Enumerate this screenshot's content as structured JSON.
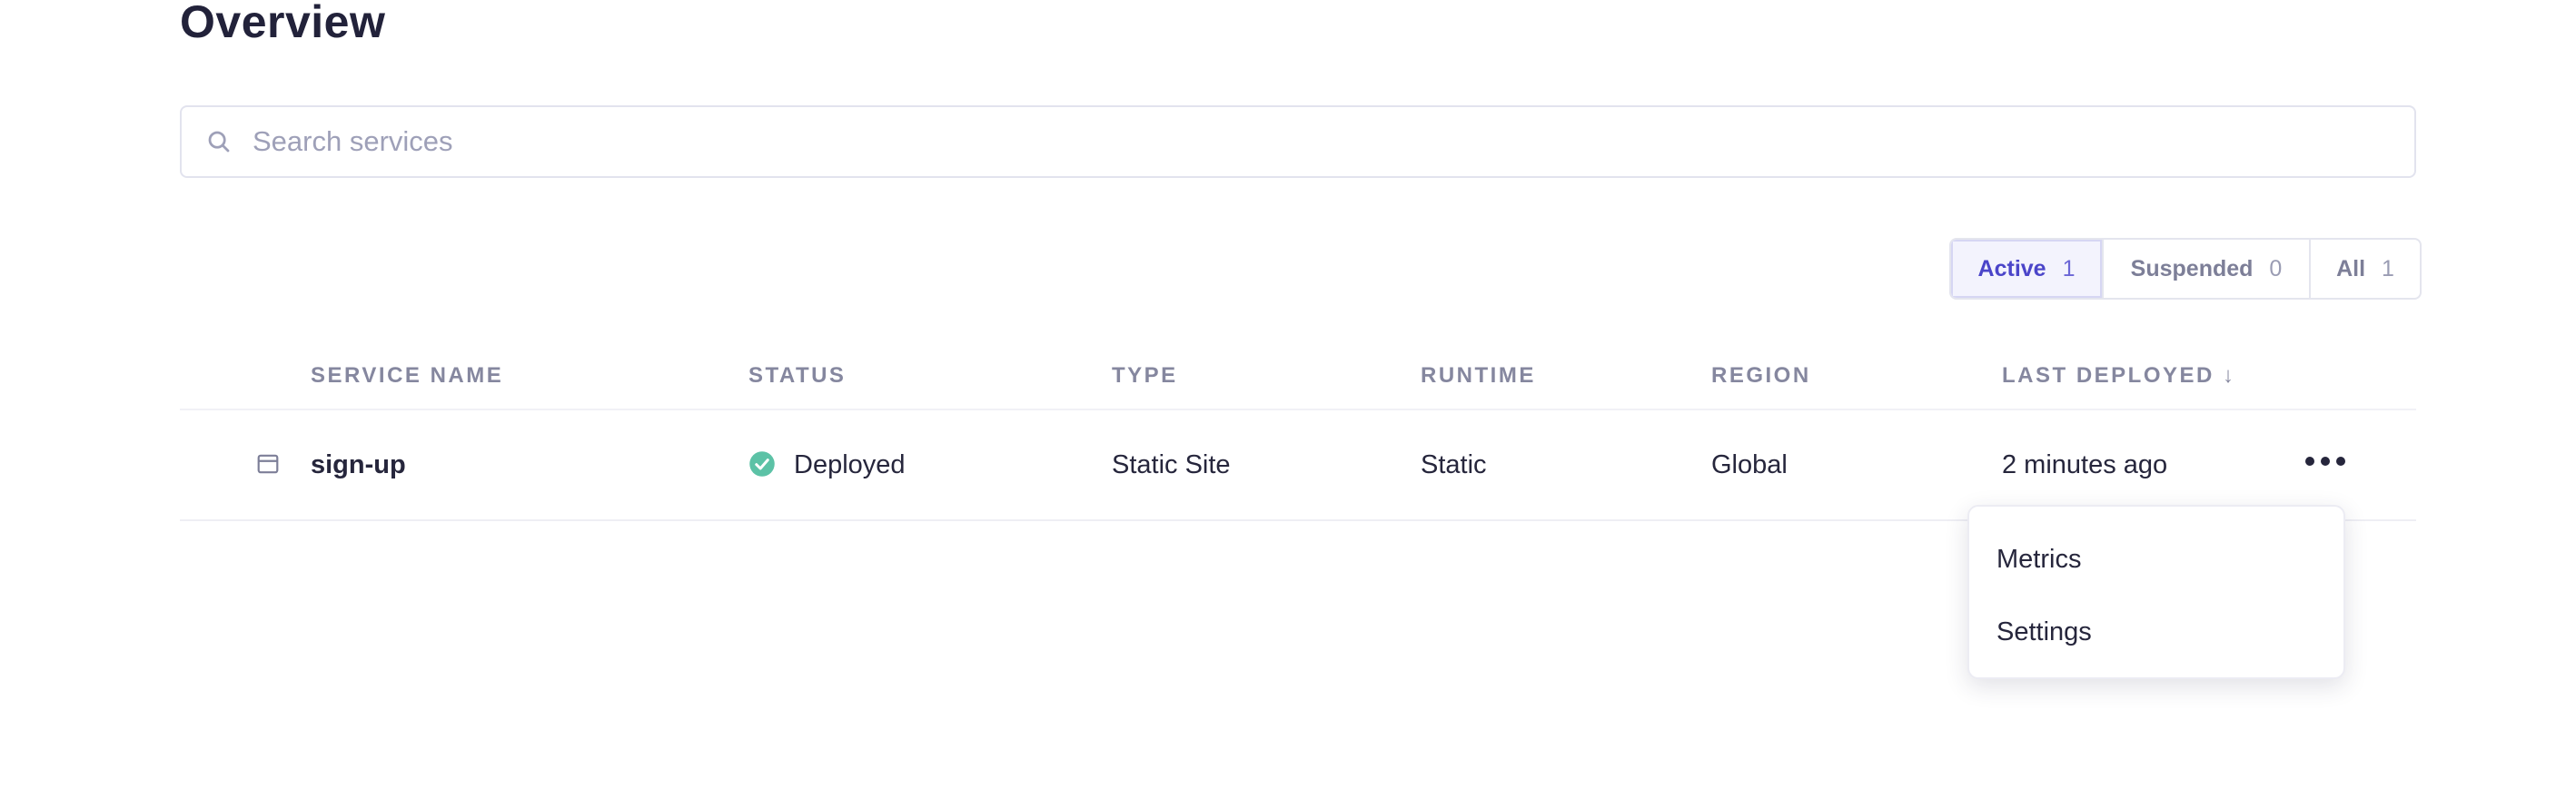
{
  "page": {
    "title": "Overview"
  },
  "search": {
    "placeholder": "Search services",
    "value": ""
  },
  "filters": [
    {
      "label": "Active",
      "count": "1",
      "selected": true
    },
    {
      "label": "Suspended",
      "count": "0",
      "selected": false
    },
    {
      "label": "All",
      "count": "1",
      "selected": false
    }
  ],
  "table": {
    "columns": {
      "service_name": "SERVICE NAME",
      "status": "STATUS",
      "type": "TYPE",
      "runtime": "RUNTIME",
      "region": "REGION",
      "last_deployed": "LAST DEPLOYED ↓"
    },
    "rows": [
      {
        "service_name": "sign-up",
        "status": "Deployed",
        "type": "Static Site",
        "runtime": "Static",
        "region": "Global",
        "last_deployed": "2 minutes ago"
      }
    ]
  },
  "row_menu": {
    "items": [
      "Metrics",
      "Settings"
    ]
  },
  "colors": {
    "accent": "#4b45c9",
    "status_success": "#5cc2a6",
    "muted": "#85879f"
  },
  "icons": {
    "search": "search-icon",
    "service": "static-site-icon",
    "status": "check-circle-icon",
    "menu": "more-horizontal-icon"
  }
}
